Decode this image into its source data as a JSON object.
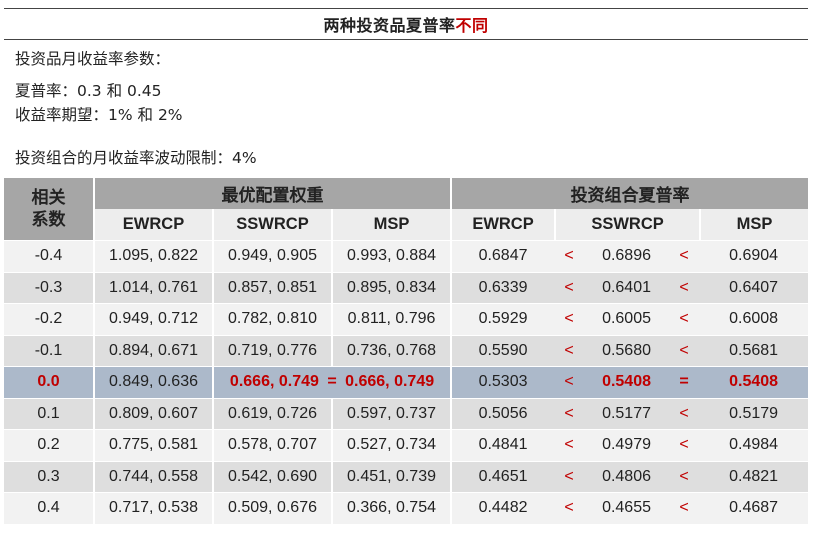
{
  "title": {
    "main": "两种投资品夏普率",
    "highlight": "不同"
  },
  "params": {
    "header": "投资品月收益率参数：",
    "sharpe": "夏普率：0.3 和 0.45",
    "expected": "收益率期望：1% 和 2%",
    "vol_limit": "投资组合的月收益率波动限制：4%"
  },
  "table": {
    "corner_line1": "相关",
    "corner_line2": "系数",
    "group_weights": "最优配置权重",
    "group_sharpe": "投资组合夏普率",
    "sub_headers": [
      "EWRCP",
      "SSWRCP",
      "MSP",
      "EWRCP",
      "SSWRCP",
      "MSP"
    ],
    "rows": [
      {
        "corr": "-0.4",
        "w_ew": "1.095, 0.822",
        "w_ss": "0.949, 0.905",
        "w_msp": "0.993, 0.884",
        "s_ew": "0.6847",
        "op1": "<",
        "s_ss": "0.6896",
        "op2": "<",
        "s_msp": "0.6904"
      },
      {
        "corr": "-0.3",
        "w_ew": "1.014, 0.761",
        "w_ss": "0.857, 0.851",
        "w_msp": "0.895, 0.834",
        "s_ew": "0.6339",
        "op1": "<",
        "s_ss": "0.6401",
        "op2": "<",
        "s_msp": "0.6407"
      },
      {
        "corr": "-0.2",
        "w_ew": "0.949, 0.712",
        "w_ss": "0.782, 0.810",
        "w_msp": "0.811, 0.796",
        "s_ew": "0.5929",
        "op1": "<",
        "s_ss": "0.6005",
        "op2": "<",
        "s_msp": "0.6008"
      },
      {
        "corr": "-0.1",
        "w_ew": "0.894, 0.671",
        "w_ss": "0.719, 0.776",
        "w_msp": "0.736, 0.768",
        "s_ew": "0.5590",
        "op1": "<",
        "s_ss": "0.5680",
        "op2": "<",
        "s_msp": "0.5681"
      },
      {
        "corr": "0.0",
        "w_ew": "0.849, 0.636",
        "w_ss": "0.666, 0.749",
        "w_eq": "=",
        "w_msp": "0.666, 0.749",
        "s_ew": "0.5303",
        "op1": "<",
        "s_ss": "0.5408",
        "op2": "=",
        "s_msp": "0.5408"
      },
      {
        "corr": "0.1",
        "w_ew": "0.809, 0.607",
        "w_ss": "0.619, 0.726",
        "w_msp": "0.597, 0.737",
        "s_ew": "0.5056",
        "op1": "<",
        "s_ss": "0.5177",
        "op2": "<",
        "s_msp": "0.5179"
      },
      {
        "corr": "0.2",
        "w_ew": "0.775, 0.581",
        "w_ss": "0.578, 0.707",
        "w_msp": "0.527, 0.734",
        "s_ew": "0.4841",
        "op1": "<",
        "s_ss": "0.4979",
        "op2": "<",
        "s_msp": "0.4984"
      },
      {
        "corr": "0.3",
        "w_ew": "0.744, 0.558",
        "w_ss": "0.542, 0.690",
        "w_msp": "0.451, 0.739",
        "s_ew": "0.4651",
        "op1": "<",
        "s_ss": "0.4806",
        "op2": "<",
        "s_msp": "0.4821"
      },
      {
        "corr": "0.4",
        "w_ew": "0.717, 0.538",
        "w_ss": "0.509, 0.676",
        "w_msp": "0.366, 0.754",
        "s_ew": "0.4482",
        "op1": "<",
        "s_ss": "0.4655",
        "op2": "<",
        "s_msp": "0.4687"
      }
    ]
  },
  "colors": {
    "accent_red": "#c00000",
    "header_gray": "#a6a6a6",
    "highlight_row": "#acb9ca"
  }
}
